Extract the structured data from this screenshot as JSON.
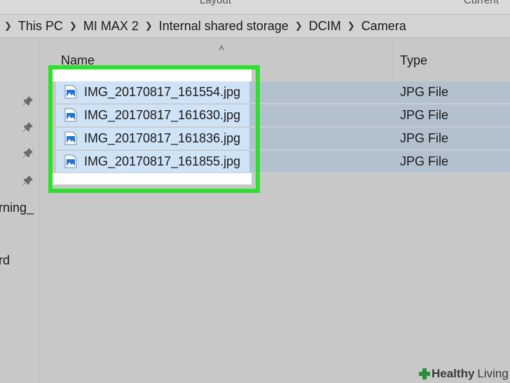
{
  "ribbon": {
    "tab_left": "Layout",
    "tab_right": "Current"
  },
  "breadcrumb": [
    "This PC",
    "MI MAX 2",
    "Internal shared storage",
    "DCIM",
    "Camera"
  ],
  "nav": {
    "item_1": "rning_",
    "item_2": "rd"
  },
  "columns": {
    "name": "Name",
    "type": "Type"
  },
  "files": [
    {
      "name": "IMG_20170817_161554.jpg",
      "type": "JPG File"
    },
    {
      "name": "IMG_20170817_161630.jpg",
      "type": "JPG File"
    },
    {
      "name": "IMG_20170817_161836.jpg",
      "type": "JPG File"
    },
    {
      "name": "IMG_20170817_161855.jpg",
      "type": "JPG File"
    }
  ],
  "watermark": {
    "brand": "Healthy",
    "suffix": "Living"
  },
  "colors": {
    "highlight": "#2ee02e",
    "selection": "#cfe3f7",
    "row_selected": "#b3c1cf"
  },
  "icons": {
    "file": "image-file-icon",
    "pin": "pin-icon",
    "caret": "sort-caret-icon"
  }
}
